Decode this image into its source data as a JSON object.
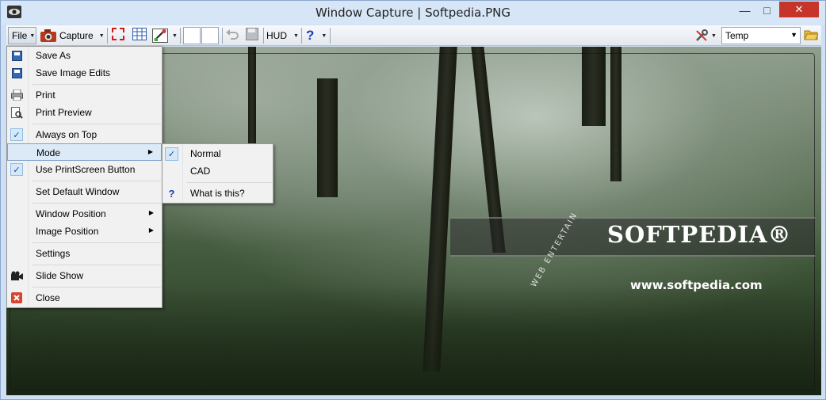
{
  "window": {
    "title": "Window Capture | Softpedia.PNG"
  },
  "toolbar": {
    "file_label": "File",
    "capture_label": "Capture",
    "hud_label": "HUD",
    "help_glyph": "?",
    "temp_value": "Temp"
  },
  "file_menu": {
    "items": [
      {
        "label": "Save As",
        "icon": "save-icon"
      },
      {
        "label": "Save Image Edits",
        "icon": "save-icon"
      },
      {
        "label": "Print",
        "icon": "printer-icon"
      },
      {
        "label": "Print Preview",
        "icon": "print-preview-icon"
      },
      {
        "label": "Always on Top",
        "icon": "check-icon",
        "checked": true
      },
      {
        "label": "Mode",
        "has_submenu": true
      },
      {
        "label": "Use PrintScreen Button",
        "icon": "check-icon",
        "checked": true
      },
      {
        "label": "Set Default Window"
      },
      {
        "label": "Window Position",
        "has_submenu": true
      },
      {
        "label": "Image Position",
        "has_submenu": true
      },
      {
        "label": "Settings"
      },
      {
        "label": "Slide Show",
        "icon": "camera-icon"
      },
      {
        "label": "Close",
        "icon": "close-icon"
      }
    ]
  },
  "mode_submenu": {
    "items": [
      {
        "label": "Normal",
        "checked": true
      },
      {
        "label": "CAD"
      },
      {
        "label": "What is this?",
        "icon": "help-icon"
      }
    ]
  },
  "image": {
    "logo_text": "SOFTPEDIA®",
    "url_text": "www.softpedia.com",
    "arc_text": "WEB ENTERTAIN"
  },
  "colors": {
    "accent": "#3467b6",
    "close_button": "#c7342a",
    "highlight": "#dceaf7"
  }
}
